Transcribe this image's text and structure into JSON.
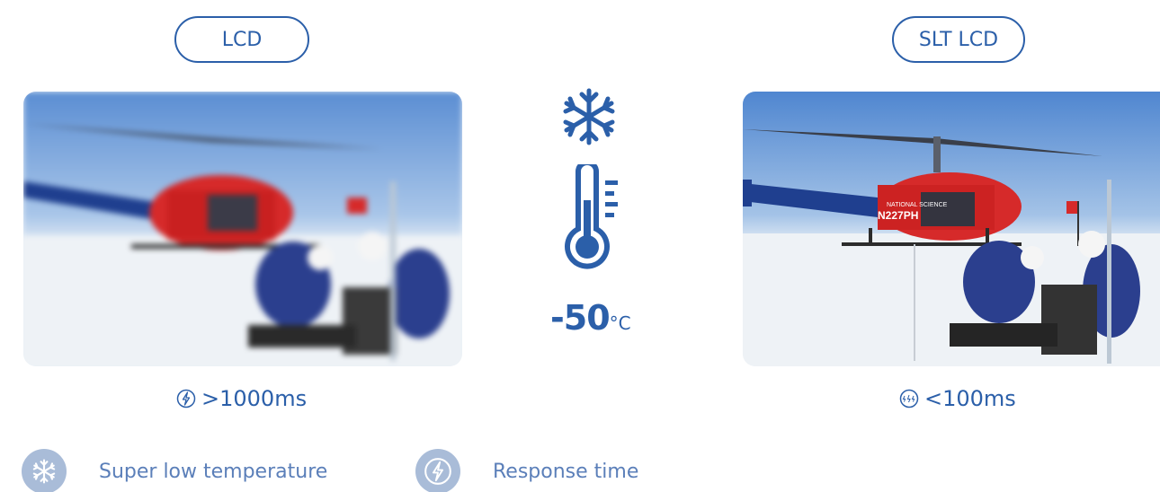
{
  "labels": {
    "left_pill": "LCD",
    "right_pill": "SLT LCD"
  },
  "temperature": {
    "value": "-50",
    "unit": "°C"
  },
  "response": {
    "left": ">1000ms",
    "right": "<100ms"
  },
  "legend": {
    "low_temp": "Super low temperature",
    "response_time": "Response time"
  },
  "icons": {
    "snowflake": "snowflake-icon",
    "thermometer": "thermometer-icon",
    "lightning": "lightning-icon"
  },
  "colors": {
    "brand_blue": "#2b5fa9",
    "legend_circle": "#a9bcd8",
    "heli_red": "#d62a2a"
  }
}
